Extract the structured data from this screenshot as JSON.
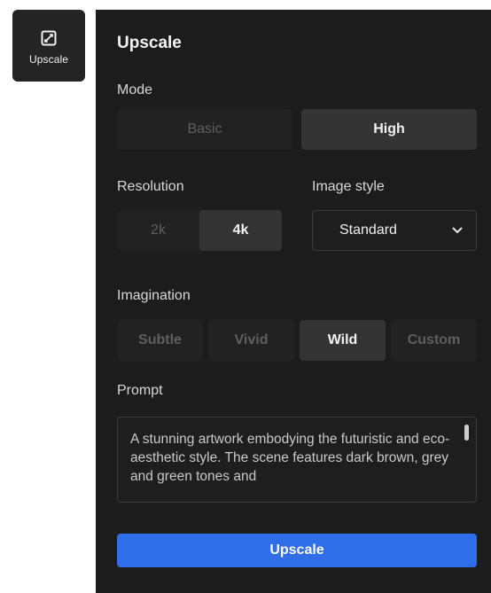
{
  "tool_button": {
    "label": "Upscale",
    "icon": "expand-icon"
  },
  "panel": {
    "title": "Upscale",
    "mode": {
      "label": "Mode",
      "options": [
        "Basic",
        "High"
      ],
      "selected": "High"
    },
    "resolution": {
      "label": "Resolution",
      "options": [
        "2k",
        "4k"
      ],
      "selected": "4k"
    },
    "image_style": {
      "label": "Image style",
      "value": "Standard",
      "icon": "chevron-down-icon"
    },
    "imagination": {
      "label": "Imagination",
      "options": [
        "Subtle",
        "Vivid",
        "Wild",
        "Custom"
      ],
      "selected": "Wild"
    },
    "prompt": {
      "label": "Prompt",
      "value": "A stunning artwork embodying the futuristic and eco-aesthetic style. The scene features dark brown, grey and green tones and"
    },
    "submit_label": "Upscale"
  },
  "colors": {
    "panel_bg": "#1c1c1c",
    "accent": "#2f6ee8",
    "segment_active": "#343434"
  }
}
